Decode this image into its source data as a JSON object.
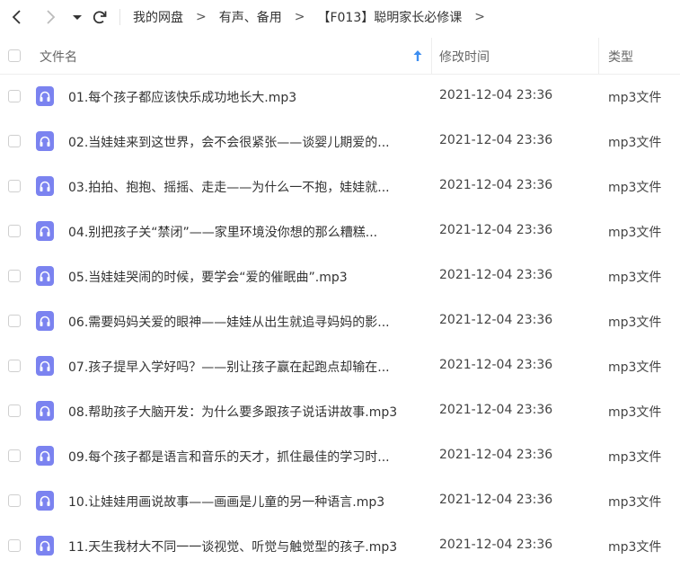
{
  "toolbar": {
    "breadcrumbs": [
      "我的网盘",
      "有声、备用",
      "【F013】聪明家长必修课"
    ],
    "separator": ">"
  },
  "header": {
    "col_name": "文件名",
    "col_time": "修改时间",
    "col_type": "类型",
    "sort": "ascending"
  },
  "files": [
    {
      "name": "01.每个孩子都应该快乐成功地长大.mp3",
      "modified": "2021-12-04 23:36",
      "type": "mp3文件"
    },
    {
      "name": "02.当娃娃来到这世界，会不会很紧张——谈婴儿期爱的...",
      "modified": "2021-12-04 23:36",
      "type": "mp3文件"
    },
    {
      "name": "03.拍拍、抱抱、摇摇、走走——为什么一不抱，娃娃就...",
      "modified": "2021-12-04 23:36",
      "type": "mp3文件"
    },
    {
      "name": "04.别把孩子关“禁闭”——家里环境没你想的那么糟糕...",
      "modified": "2021-12-04 23:36",
      "type": "mp3文件"
    },
    {
      "name": "05.当娃娃哭闹的时候，要学会“爱的催眠曲”.mp3",
      "modified": "2021-12-04 23:36",
      "type": "mp3文件"
    },
    {
      "name": "06.需要妈妈关爱的眼神——娃娃从出生就追寻妈妈的影...",
      "modified": "2021-12-04 23:36",
      "type": "mp3文件"
    },
    {
      "name": "07.孩子提早入学好吗？——别让孩子赢在起跑点却输在...",
      "modified": "2021-12-04 23:36",
      "type": "mp3文件"
    },
    {
      "name": "08.帮助孩子大脑开发：为什么要多跟孩子说话讲故事.mp3",
      "modified": "2021-12-04 23:36",
      "type": "mp3文件"
    },
    {
      "name": "09.每个孩子都是语言和音乐的天才，抓住最佳的学习时...",
      "modified": "2021-12-04 23:36",
      "type": "mp3文件"
    },
    {
      "name": "10.让娃娃用画说故事——画画是儿童的另一种语言.mp3",
      "modified": "2021-12-04 23:36",
      "type": "mp3文件"
    },
    {
      "name": "11.天生我材大不同一一谈视觉、听觉与触觉型的孩子.mp3",
      "modified": "2021-12-04 23:36",
      "type": "mp3文件"
    }
  ],
  "colors": {
    "file_icon": "#7b83f0",
    "sort_arrow": "#3d8ef0"
  },
  "icons": [
    "back-icon",
    "forward-icon",
    "dropdown-icon",
    "refresh-icon",
    "sort-up-icon",
    "headphones-icon"
  ]
}
